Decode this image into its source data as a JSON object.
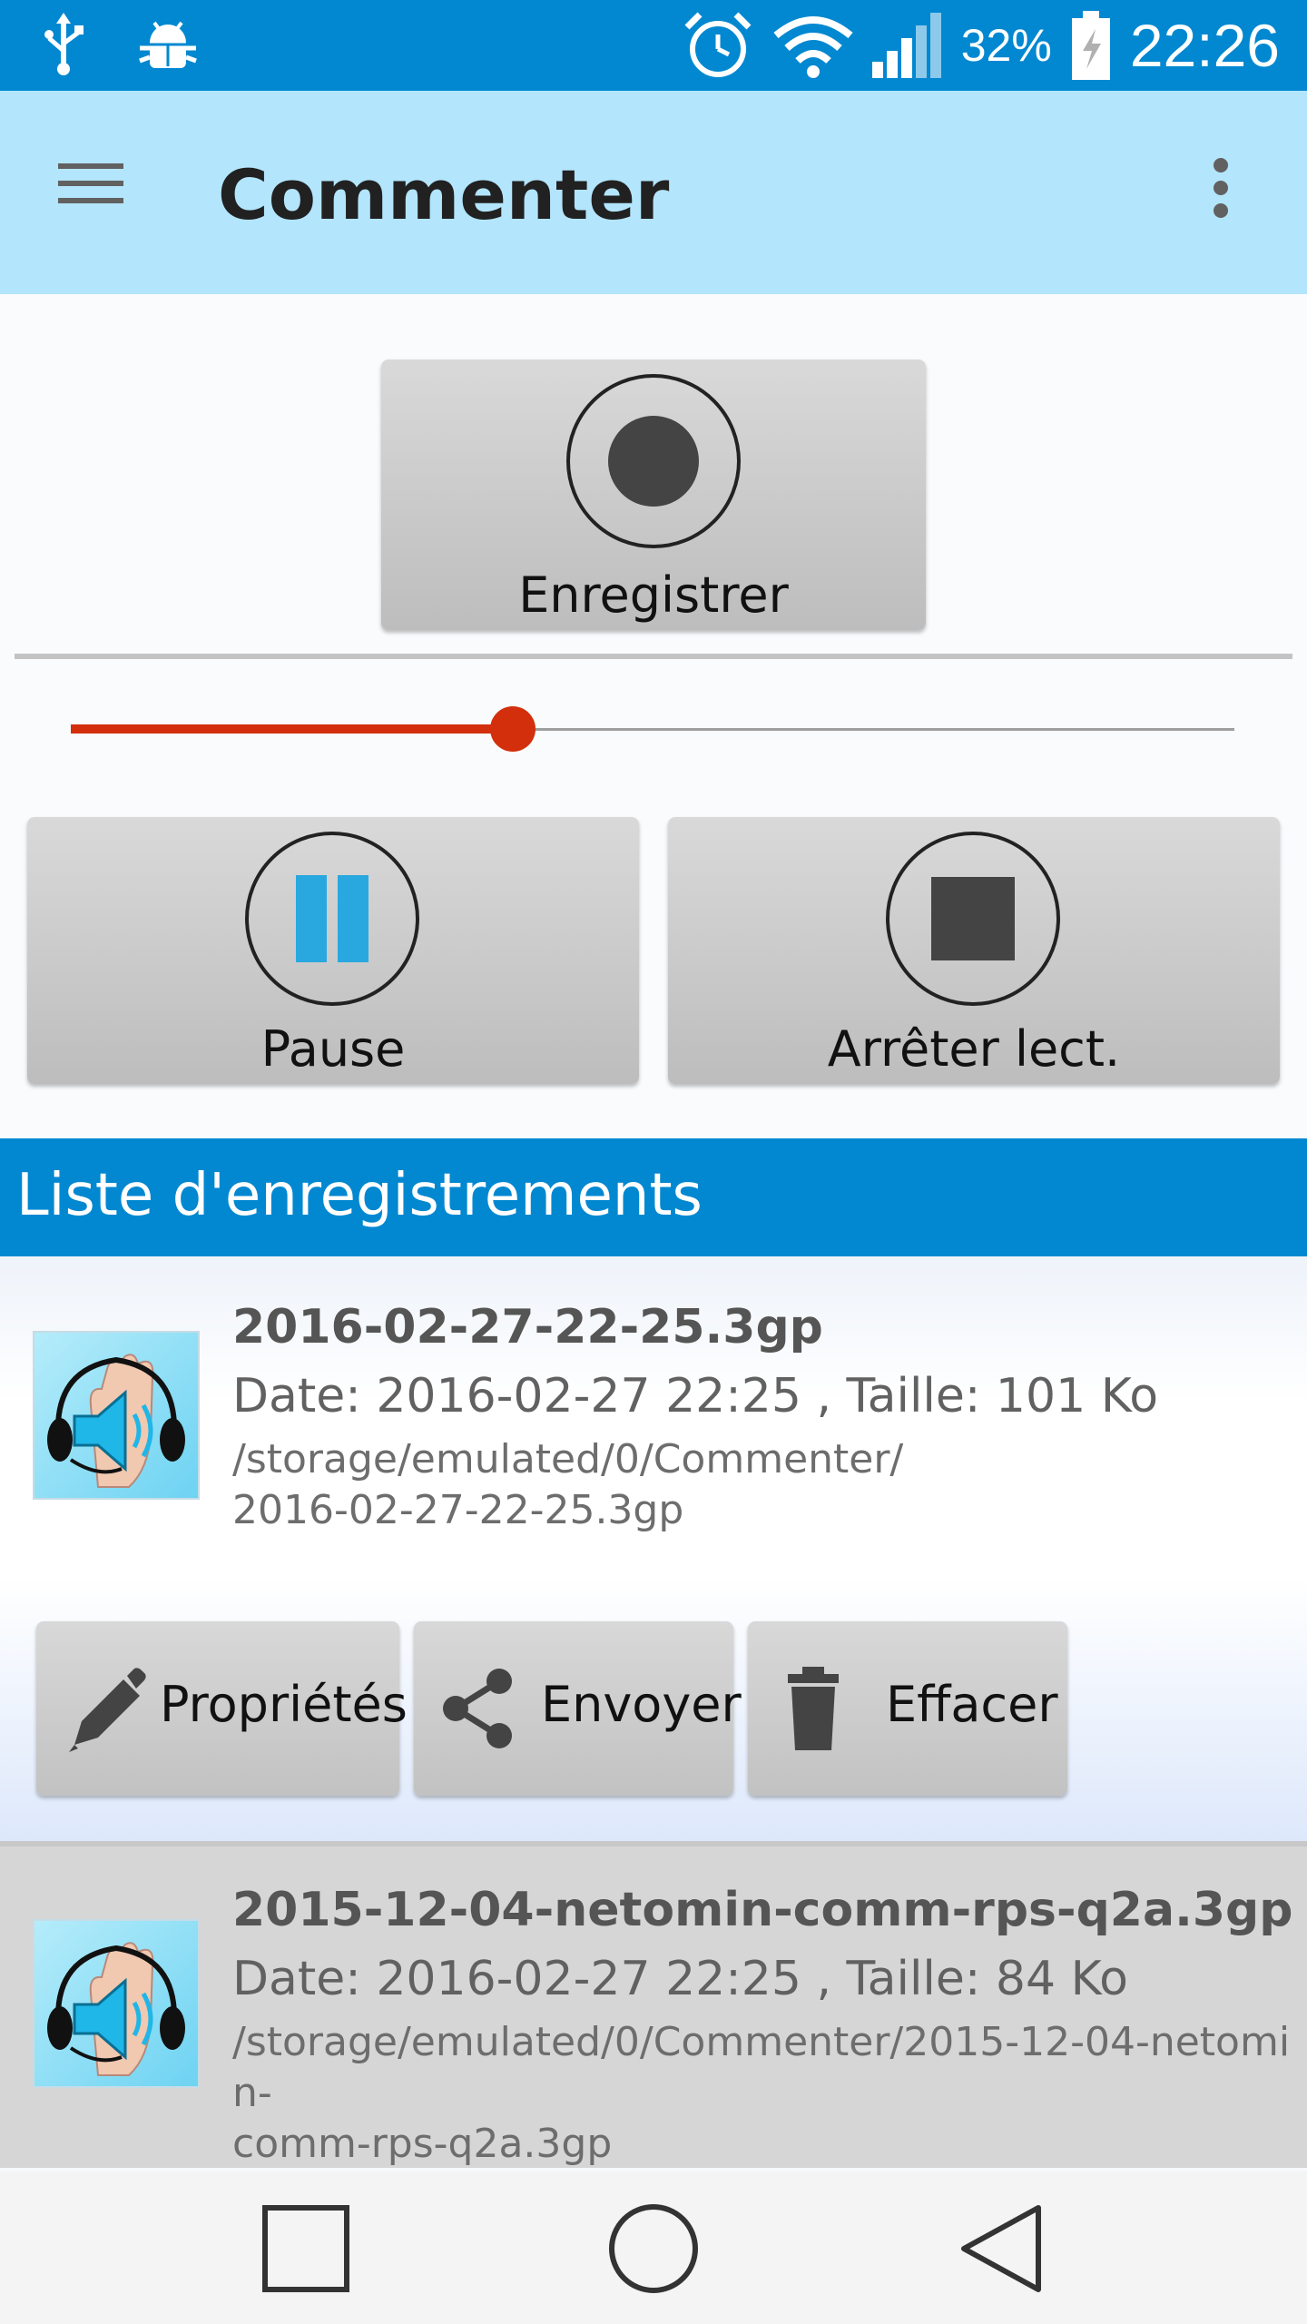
{
  "status_bar": {
    "battery_percent": "32%",
    "time": "22:26",
    "icons": [
      "usb-icon",
      "android-debug-icon",
      "alarm-icon",
      "wifi-icon",
      "signal-icon",
      "battery-charging-icon"
    ]
  },
  "app_bar": {
    "title": "Commenter",
    "menu_icon": "hamburger-menu-icon",
    "overflow_icon": "more-vert-icon"
  },
  "controls": {
    "record_label": "Enregistrer",
    "pause_label": "Pause",
    "stop_label": "Arrêter lect.",
    "seek_progress": 0.38,
    "colors": {
      "seek": "#d32f0d",
      "pause_icon": "#29a8e0",
      "accent": "#0288d1"
    }
  },
  "recordings": {
    "header": "Liste d'enregistrements",
    "items": [
      {
        "filename": "2016-02-27-22-25.3gp",
        "meta": "Date: 2016-02-27 22:25 , Taille: 101 Ko",
        "path_line1": "/storage/emulated/0/Commenter/",
        "path_line2": "2016-02-27-22-25.3gp",
        "actions": {
          "properties_label": "Propriétés",
          "send_label": "Envoyer",
          "delete_label": "Effacer"
        }
      },
      {
        "filename": "2015-12-04-netomin-comm-rps-q2a.3gp",
        "meta": "Date: 2016-02-27 22:25 , Taille: 84 Ko",
        "path_line1": "/storage/emulated/0/Commenter/2015-12-04-netomin-",
        "path_line2": "comm-rps-q2a.3gp"
      }
    ]
  },
  "nav_bar": {
    "icons": [
      "recents-icon",
      "home-icon",
      "back-icon"
    ]
  }
}
